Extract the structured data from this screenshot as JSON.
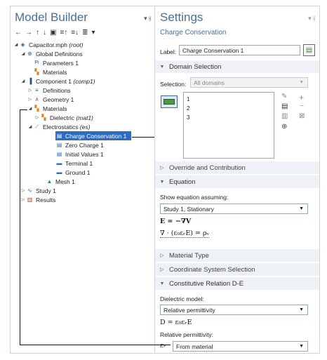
{
  "model_builder": {
    "title": "Model Builder",
    "pin": "▾ ⫲",
    "toolbar": [
      "←",
      "→",
      "↑",
      "↓",
      "▣",
      "≡↑",
      "≡↓",
      "≣",
      "▾"
    ],
    "tree": [
      {
        "label": "Capacitor.mph",
        "suffix": "(root)",
        "toggle": "◢",
        "icon": "◈",
        "color": "#3a5a8c"
      },
      {
        "label": "Global Definitions",
        "suffix": "",
        "toggle": "◢",
        "icon": "⊕",
        "color": "#3a6aa0"
      },
      {
        "label": "Parameters 1",
        "suffix": "",
        "toggle": "",
        "icon": "Pi",
        "color": "#2b4f80"
      },
      {
        "label": "Materials",
        "suffix": "",
        "toggle": "",
        "icon": "▚",
        "color": "#d98a1e"
      },
      {
        "label": "Component 1",
        "suffix": "(comp1)",
        "toggle": "◢",
        "icon": "▐",
        "color": "#2b4f80"
      },
      {
        "label": "Definitions",
        "suffix": "",
        "toggle": "▷",
        "icon": "≡",
        "color": "#3a5a8c"
      },
      {
        "label": "Geometry 1",
        "suffix": "",
        "toggle": "▷",
        "icon": "∧",
        "color": "#c0392b"
      },
      {
        "label": "Materials",
        "suffix": "",
        "toggle": "◢",
        "icon": "▚",
        "color": "#d98a1e"
      },
      {
        "label": "Dielectric",
        "suffix": "(mat1)",
        "toggle": "▷",
        "icon": "▚",
        "color": "#d98a1e"
      },
      {
        "label": "Electrostatics",
        "suffix": "(es)",
        "toggle": "◢",
        "icon": "⟋",
        "color": "#2b6cc4"
      },
      {
        "label": "Charge Conservation 1",
        "suffix": "",
        "toggle": "",
        "icon": "▤",
        "color": "#2b6cc4"
      },
      {
        "label": "Zero Charge 1",
        "suffix": "",
        "toggle": "",
        "icon": "▤",
        "color": "#2b6cc4"
      },
      {
        "label": "Initial Values 1",
        "suffix": "",
        "toggle": "",
        "icon": "▤",
        "color": "#2b6cc4"
      },
      {
        "label": "Terminal 1",
        "suffix": "",
        "toggle": "",
        "icon": "▬",
        "color": "#2b6cc4"
      },
      {
        "label": "Ground 1",
        "suffix": "",
        "toggle": "",
        "icon": "▬",
        "color": "#2b6cc4"
      },
      {
        "label": "Mesh 1",
        "suffix": "",
        "toggle": "",
        "icon": "▲",
        "color": "#3a8a6a"
      },
      {
        "label": "Study 1",
        "suffix": "",
        "toggle": "▷",
        "icon": "∿",
        "color": "#2b6cc4"
      },
      {
        "label": "Results",
        "suffix": "",
        "toggle": "▷",
        "icon": "▥",
        "color": "#c0392b"
      }
    ]
  },
  "settings": {
    "title": "Settings",
    "subtitle": "Charge Conservation",
    "pin": "▾ ⫲",
    "label_caption": "Label:",
    "label_value": "Charge Conservation 1",
    "domain_selection": {
      "header": "Domain Selection",
      "selection_caption": "Selection:",
      "selection_value": "All domains",
      "items": [
        "1",
        "2",
        "3"
      ]
    },
    "override_header": "Override and Contribution",
    "equation": {
      "header": "Equation",
      "show_caption": "Show equation assuming:",
      "study_value": "Study 1, Stationary",
      "eq1": "E = −∇V",
      "eq2": "∇ · (ε₀εᵣE) = ρᵥ"
    },
    "material_type_header": "Material Type",
    "coord_header": "Coordinate System Selection",
    "constitutive": {
      "header": "Constitutive Relation D-E",
      "dielectric_caption": "Dielectric model:",
      "dielectric_value": "Relative permittivity",
      "eq": "D = ε₀εᵣE",
      "rel_caption": "Relative permittivity:",
      "eps_symbol": "εᵣ",
      "rel_value": "From material"
    }
  }
}
